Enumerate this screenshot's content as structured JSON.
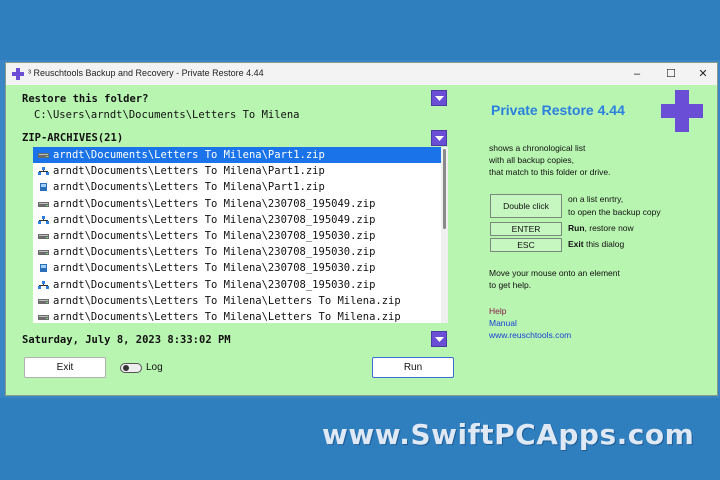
{
  "window": {
    "title": "³ Reuschtools Backup and Recovery - Private Restore 4.44",
    "minimize": "–",
    "maximize": "☐",
    "close": "✕"
  },
  "restore": {
    "label": "Restore this folder?",
    "path": "C:\\Users\\arndt\\Documents\\Letters To Milena"
  },
  "archives": {
    "label": "ZIP-ARCHIVES(21)",
    "items": [
      {
        "text": "arndt\\Documents\\Letters To Milena\\Part1.zip",
        "icon": "drive-icon",
        "selected": true
      },
      {
        "text": "arndt\\Documents\\Letters To Milena\\Part1.zip",
        "icon": "network-icon",
        "selected": false
      },
      {
        "text": "arndt\\Documents\\Letters To Milena\\Part1.zip",
        "icon": "usb-icon",
        "selected": false
      },
      {
        "text": "arndt\\Documents\\Letters To Milena\\230708_195049.zip",
        "icon": "drive-icon",
        "selected": false
      },
      {
        "text": "arndt\\Documents\\Letters To Milena\\230708_195049.zip",
        "icon": "network-icon",
        "selected": false
      },
      {
        "text": "arndt\\Documents\\Letters To Milena\\230708_195030.zip",
        "icon": "drive-icon",
        "selected": false
      },
      {
        "text": "arndt\\Documents\\Letters To Milena\\230708_195030.zip",
        "icon": "drive-icon",
        "selected": false
      },
      {
        "text": "arndt\\Documents\\Letters To Milena\\230708_195030.zip",
        "icon": "usb-icon",
        "selected": false
      },
      {
        "text": "arndt\\Documents\\Letters To Milena\\230708_195030.zip",
        "icon": "network-icon",
        "selected": false
      },
      {
        "text": "arndt\\Documents\\Letters To Milena\\Letters To Milena.zip",
        "icon": "drive-icon",
        "selected": false
      },
      {
        "text": "arndt\\Documents\\Letters To Milena\\Letters To Milena.zip",
        "icon": "drive-icon",
        "selected": false
      }
    ]
  },
  "date": "Saturday, July 8, 2023  8:33:02 PM",
  "buttons": {
    "exit": "Exit",
    "log": "Log",
    "run": "Run"
  },
  "brand": {
    "title": "Private Restore 4.44"
  },
  "info": {
    "line1": "shows a chronological list",
    "line2": "with all backup copies,",
    "line3": "that match to this folder or drive.",
    "double_click_btn": "Double click",
    "double_click_desc1": "on a list enrtry,",
    "double_click_desc2": "to open the backup copy",
    "enter_btn": "ENTER",
    "enter_desc_bold": "Run",
    "enter_desc_rest": ", restore now",
    "esc_btn": "ESC",
    "esc_desc_bold": "Exit",
    "esc_desc_rest": " this dialog",
    "hint1": "Move your mouse onto an element",
    "hint2": "to get help."
  },
  "links": {
    "help": "Help",
    "manual": "Manual",
    "web": "www.reuschtools.com"
  },
  "watermark": "www.SwiftPCApps.com",
  "colors": {
    "accent": "#2a7fe0",
    "selection": "#1a73e8",
    "window_bg": "#b8f5b0",
    "dropdown": "#6a4fd6"
  }
}
